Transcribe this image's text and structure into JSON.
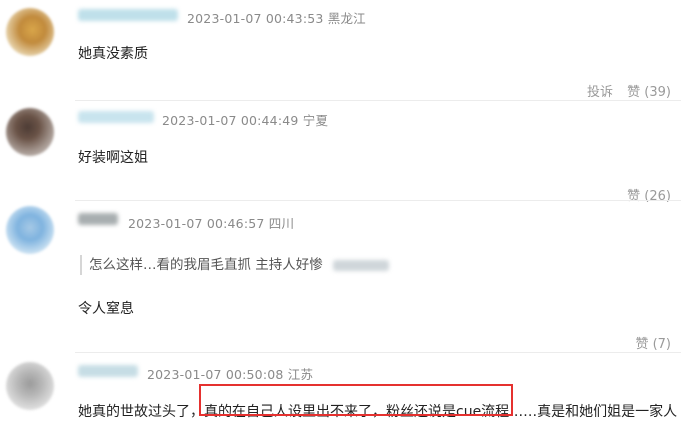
{
  "comments": [
    {
      "timestamp": "2023-01-07 00:43:53",
      "location": "黑龙江",
      "text": "她真没素质",
      "report_label": "投诉",
      "like_label": "赞 (39)"
    },
    {
      "timestamp": "2023-01-07 00:44:49",
      "location": "宁夏",
      "text": "好装啊这姐",
      "like_label": "赞 (26)"
    },
    {
      "timestamp": "2023-01-07 00:46:57",
      "location": "四川",
      "quote_text": "怎么这样…看的我眉毛直抓 主持人好惨",
      "text": "令人窒息",
      "like_label": "赞 (7)"
    },
    {
      "timestamp": "2023-01-07 00:50:08",
      "location": "江苏",
      "text": "她真的世故过头了，真的在自己人设里出不来了，粉丝还说是cue流程……真是和她们姐是一家人"
    }
  ],
  "highlight_color": "#e5312f"
}
